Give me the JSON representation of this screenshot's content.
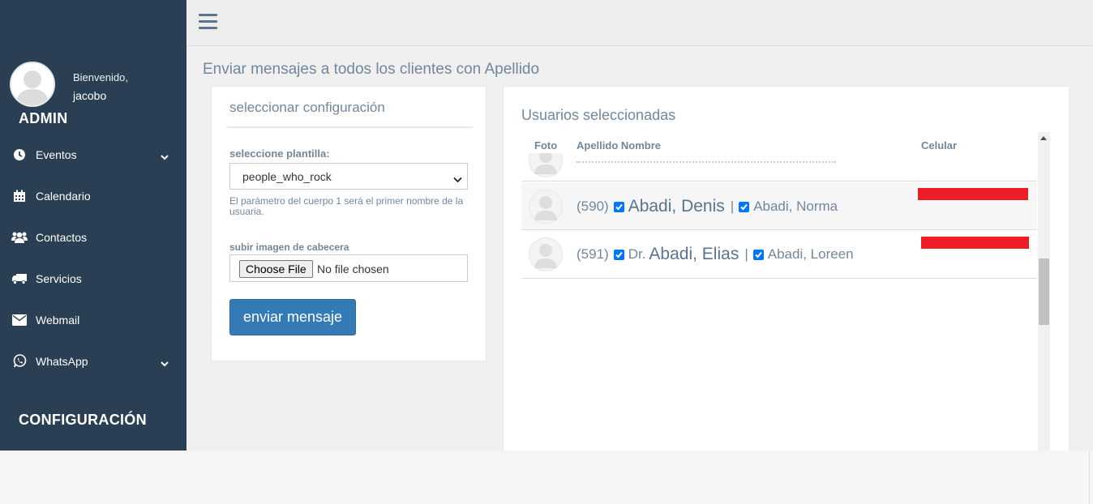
{
  "sidebar": {
    "welcome": "Bienvenido,",
    "username": "jacobo",
    "section_title": "ADMIN",
    "items": [
      {
        "label": "Eventos",
        "icon": "clock-icon",
        "has_submenu": true
      },
      {
        "label": "Calendario",
        "icon": "calendar-icon",
        "has_submenu": false
      },
      {
        "label": "Contactos",
        "icon": "users-icon",
        "has_submenu": false
      },
      {
        "label": "Servicios",
        "icon": "truck-icon",
        "has_submenu": false
      },
      {
        "label": "Webmail",
        "icon": "envelope-icon",
        "has_submenu": false
      },
      {
        "label": "WhatsApp",
        "icon": "whatsapp-icon",
        "has_submenu": true
      }
    ],
    "config_title": "CONFIGURACIÓN"
  },
  "page": {
    "title": "Enviar mensajes a todos los clientes con Apellido"
  },
  "config_panel": {
    "title": "seleccionar configuración",
    "template_label": "seleccione plantilla:",
    "template_value": "people_who_rock",
    "help_text": "El parámetro del cuerpo 1 será el primer nombre de la usuaria.",
    "upload_label": "subir imagen de cabecera",
    "file_button": "Choose File",
    "file_status": "No file chosen",
    "send_button": "enviar mensaje"
  },
  "users_panel": {
    "title": "Usuarios seleccionadas",
    "columns": [
      "Foto",
      "Apellido Nombre",
      "Celular"
    ],
    "rows": [
      {
        "id": "(590)",
        "checked": true,
        "prefix": "",
        "name": "Abadi, Denis",
        "separator": "|",
        "spouse_checked": true,
        "spouse": "Abadi, Norma",
        "phone_redacted": true
      },
      {
        "id": "(591)",
        "checked": true,
        "prefix": "Dr.",
        "name": "Abadi, Elias",
        "separator": "|",
        "spouse_checked": true,
        "spouse": "Abadi, Loreen",
        "phone_redacted": true
      }
    ]
  },
  "colors": {
    "sidebar_bg": "#2a3f54",
    "primary_button": "#337ab7",
    "text_muted": "#73879c",
    "redaction": "#ee1c25",
    "checkbox": "#0075ff"
  }
}
